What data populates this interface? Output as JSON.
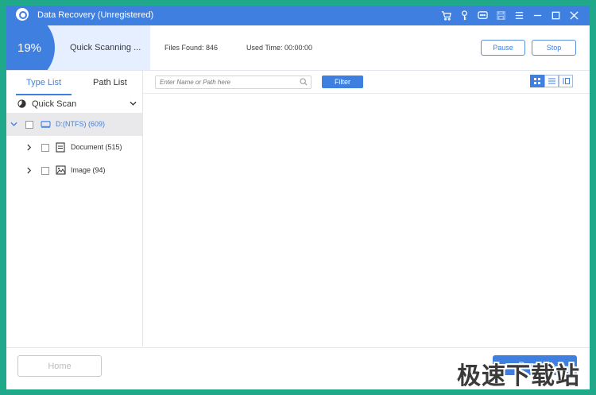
{
  "window": {
    "title": "Data Recovery (Unregistered)"
  },
  "titlebar_icons": [
    "cart-icon",
    "key-icon",
    "chat-icon",
    "save-icon",
    "menu-icon",
    "minimize-icon",
    "maximize-icon",
    "close-icon"
  ],
  "scan": {
    "progress": 0.19,
    "percent_label": "19%",
    "status": "Quick Scanning ...",
    "files_found": "Files Found: 846",
    "used_time": "Used Time: 00:00:00",
    "pause_label": "Pause",
    "stop_label": "Stop"
  },
  "sidebar": {
    "tabs": [
      {
        "label": "Type List",
        "active": true
      },
      {
        "label": "Path List",
        "active": false
      }
    ],
    "quick_scan_label": "Quick Scan",
    "tree": [
      {
        "label": "D:(NTFS) (609)",
        "selected": true,
        "expanded": true
      },
      {
        "label": "Document (515)"
      },
      {
        "label": "Image (94)"
      }
    ]
  },
  "toolbar": {
    "search_placeholder": "Enter Name or Path here",
    "filter_label": "Filter"
  },
  "footer": {
    "home_label": "Home",
    "recover_label": "Recover"
  },
  "watermark": "极速下载站",
  "colors": {
    "accent": "#3f7fe0",
    "border_frame": "#1fa98a",
    "panel_light": "#e5efff"
  }
}
